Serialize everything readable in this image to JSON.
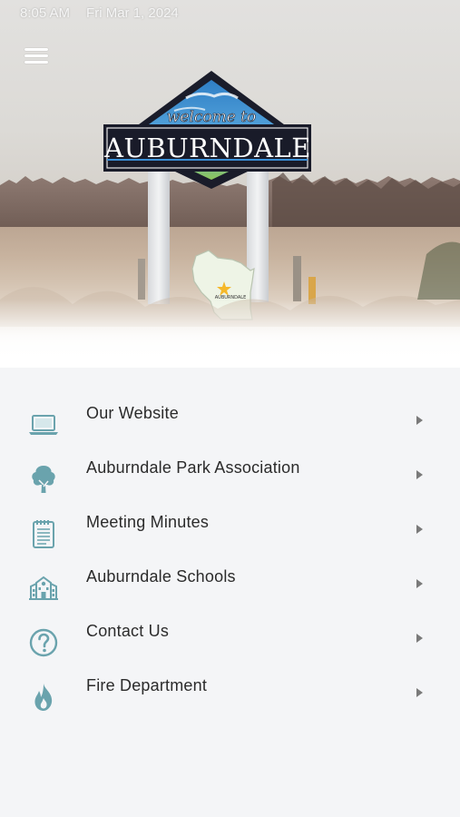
{
  "status_bar": {
    "time": "8:05 AM",
    "date": "Fri Mar 1, 2024"
  },
  "hero": {
    "sign_welcome": "welcome to",
    "sign_town": "AUBURNDALE",
    "map_label": "AUBURNDALE"
  },
  "colors": {
    "icon_accent": "#6aa3ad",
    "text": "#2b2b2b",
    "background": "#f4f5f7",
    "chevron": "#7a7a7a"
  },
  "menu": {
    "items": [
      {
        "label": "Our Website",
        "icon": "laptop-icon"
      },
      {
        "label": "Auburndale Park Association",
        "icon": "tree-icon"
      },
      {
        "label": "Meeting Minutes",
        "icon": "notepad-icon"
      },
      {
        "label": "Auburndale Schools",
        "icon": "school-icon"
      },
      {
        "label": "Contact Us",
        "icon": "question-icon"
      },
      {
        "label": "Fire Department",
        "icon": "fire-icon"
      }
    ]
  }
}
